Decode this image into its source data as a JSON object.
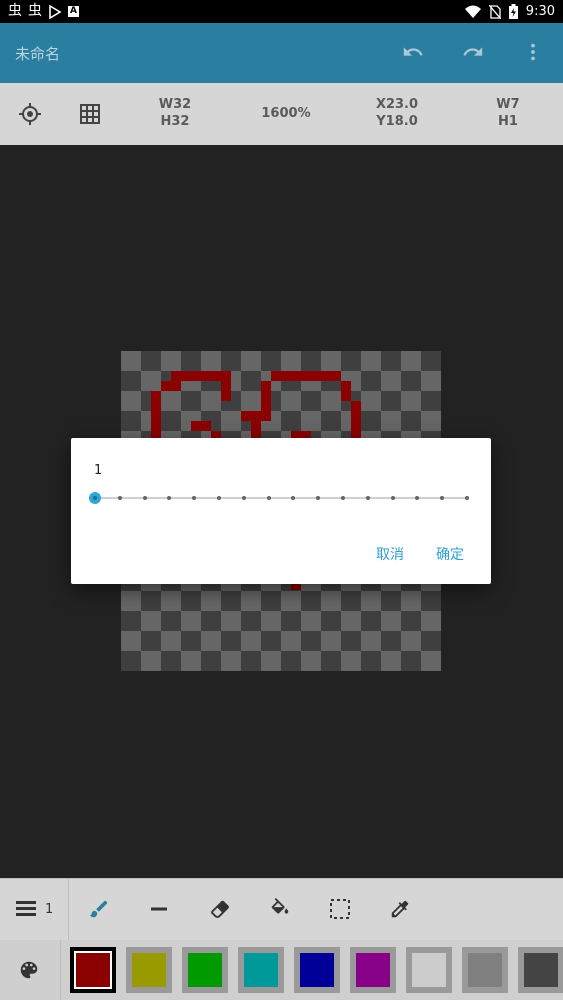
{
  "status_bar": {
    "left_icons": [
      "app-icon-1",
      "app-icon-2",
      "play-store-icon",
      "font-a-icon"
    ],
    "right_icons": [
      "wifi-icon",
      "no-sim-icon",
      "battery-charging-icon"
    ],
    "time": "9:30"
  },
  "app_bar": {
    "title": "未命名",
    "icons": [
      "undo-icon",
      "redo-icon",
      "more-vert-icon"
    ],
    "color": "#2a7fa0"
  },
  "info_bar": {
    "icons": [
      "crosshair-icon",
      "grid-icon"
    ],
    "canvas_w": "W32",
    "canvas_h": "H32",
    "zoom": "1600%",
    "cursor_x": "X23.0",
    "cursor_y": "Y18.0",
    "selection_w": "W7",
    "selection_h": "H1"
  },
  "dialog": {
    "value_label": "1",
    "slider": {
      "min": 1,
      "max": 16,
      "value": 1,
      "steps": 16
    },
    "cancel_label": "取消",
    "ok_label": "确定",
    "accent": "#2fa1d2"
  },
  "tools": {
    "layers_icon": "layers-icon",
    "layer_count": "1",
    "items": [
      "brush-icon",
      "line-icon",
      "eraser-icon",
      "fill-bucket-icon",
      "selection-icon",
      "eyedropper-icon"
    ]
  },
  "palette": {
    "icon": "palette-icon",
    "colors": [
      "#8b0000",
      "#999900",
      "#009900",
      "#009999",
      "#000099",
      "#880088",
      "#cccccc",
      "#808080",
      "#444444"
    ],
    "selected_index": 0
  }
}
